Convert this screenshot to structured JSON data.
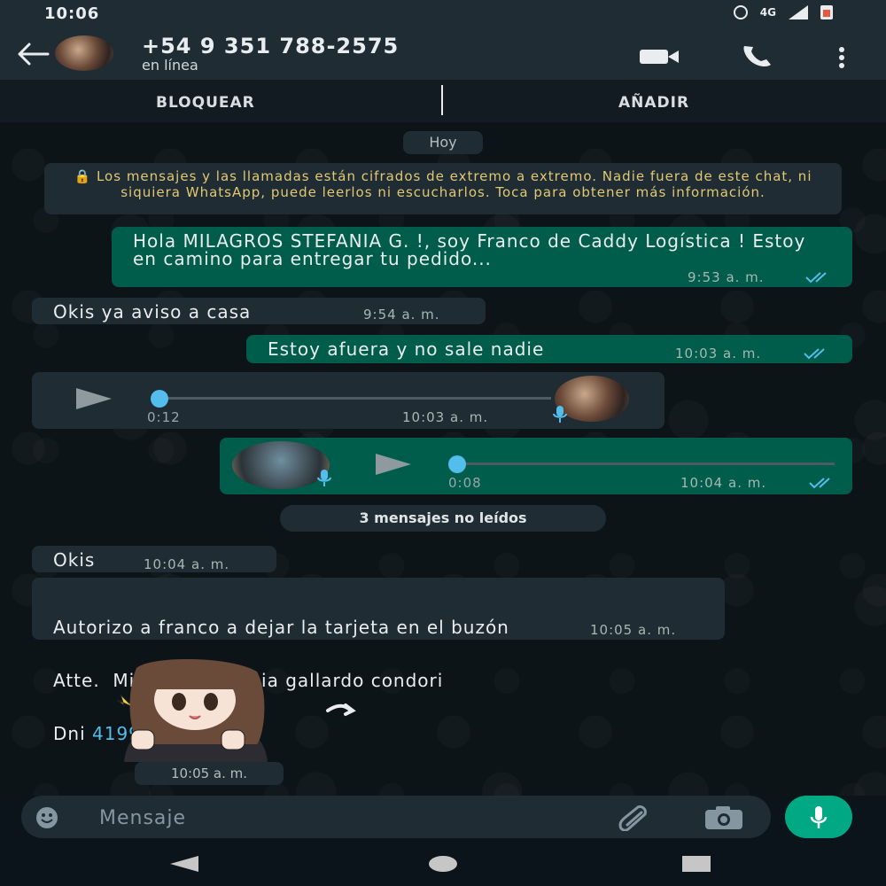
{
  "status_bar": {
    "time": "10:06",
    "network": "4G"
  },
  "header": {
    "contact_name": "+54 9 351 788-2575",
    "contact_status": "en línea",
    "icons": [
      "back-arrow-icon",
      "video-call-icon",
      "phone-icon",
      "more-options-icon"
    ]
  },
  "action_bar": {
    "block_label": "BLOQUEAR",
    "add_label": "AÑADIR"
  },
  "chat": {
    "date_label": "Hoy",
    "encryption_notice": "🔒 Los mensajes y las llamadas están cifrados de extremo a extremo. Nadie fuera de este chat, ni siquiera WhatsApp, puede leerlos ni escucharlos. Toca para obtener más información.",
    "messages": [
      {
        "direction": "out",
        "text": "Hola MILAGROS STEFANIA G. !, soy Franco de Caddy Logística ! Estoy en camino para entregar tu pedido...",
        "time": "9:53 a. m.",
        "read": true
      },
      {
        "direction": "in",
        "text": "Okis ya aviso a casa",
        "time": "9:54 a. m."
      },
      {
        "direction": "out",
        "text": "Estoy afuera y no sale nadie",
        "time": "10:03 a. m.",
        "read": true
      },
      {
        "direction": "in",
        "type": "voice",
        "duration": "0:12",
        "time": "10:03 a. m.",
        "progress": 0
      },
      {
        "direction": "out",
        "type": "voice",
        "duration": "0:08",
        "time": "10:04 a. m.",
        "progress": 0,
        "read": true
      },
      {
        "direction": "in",
        "text": "Okis",
        "time": "10:04 a. m."
      },
      {
        "direction": "in",
        "text_line1": "Autorizo a franco a dejar la tarjeta en el buzón",
        "text_line2": "Atte.  Milagros stefania gallardo condori",
        "text_line3_prefix": "Dni ",
        "text_line3_link": "41992856",
        "time": "10:05 a. m."
      },
      {
        "direction": "in",
        "type": "sticker",
        "time": "10:05 a. m."
      }
    ],
    "unread_label": "3 mensajes no leídos"
  },
  "composer": {
    "placeholder": "Mensaje"
  },
  "colors": {
    "outgoing_bubble": "#005c4b",
    "incoming_bubble": "#1f2c34",
    "accent": "#00a884",
    "read_ticks": "#53bdeb",
    "link": "#53bdeb",
    "notice_text": "#e2c872"
  }
}
